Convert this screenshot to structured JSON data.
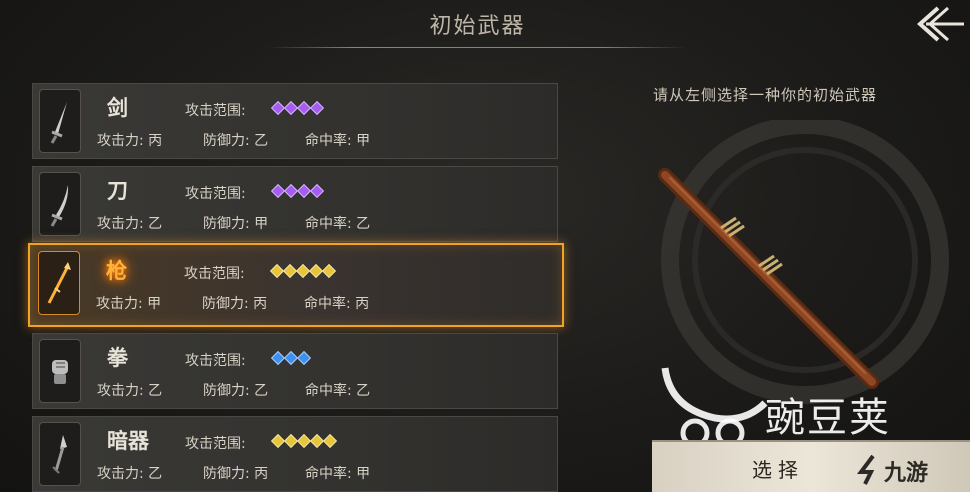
{
  "header": {
    "title": "初始武器",
    "back_icon": "back-arrow-icon"
  },
  "labels": {
    "range": "攻击范围:",
    "attack": "攻击力:",
    "defense": "防御力:",
    "hit": "命中率:"
  },
  "weapons": [
    {
      "name": "剑",
      "attack": "丙",
      "defense": "乙",
      "hit": "甲",
      "range_level": 4,
      "gem_color": "#a55cf0",
      "icon": "sword-icon",
      "selected": false
    },
    {
      "name": "刀",
      "attack": "乙",
      "defense": "甲",
      "hit": "乙",
      "range_level": 4,
      "gem_color": "#a55cf0",
      "icon": "saber-icon",
      "selected": false
    },
    {
      "name": "枪",
      "attack": "甲",
      "defense": "丙",
      "hit": "丙",
      "range_level": 5,
      "gem_color": "#e6c53a",
      "icon": "spear-icon",
      "selected": true
    },
    {
      "name": "拳",
      "attack": "乙",
      "defense": "乙",
      "hit": "乙",
      "range_level": 3,
      "gem_color": "#3f8ff0",
      "icon": "fist-icon",
      "selected": false
    },
    {
      "name": "暗器",
      "attack": "乙",
      "defense": "丙",
      "hit": "甲",
      "range_level": 5,
      "gem_color": "#e6c53a",
      "icon": "dart-icon",
      "selected": false
    }
  ],
  "detail": {
    "hint": "请从左侧选择一种你的初始武器",
    "select_label": "选择",
    "preview_icon": "staff-icon"
  },
  "watermarks": {
    "wandoujia": "豌豆荚",
    "jiuyou": "九游"
  },
  "colors": {
    "accent": "#f0a328",
    "bg": "#1c1b19"
  }
}
